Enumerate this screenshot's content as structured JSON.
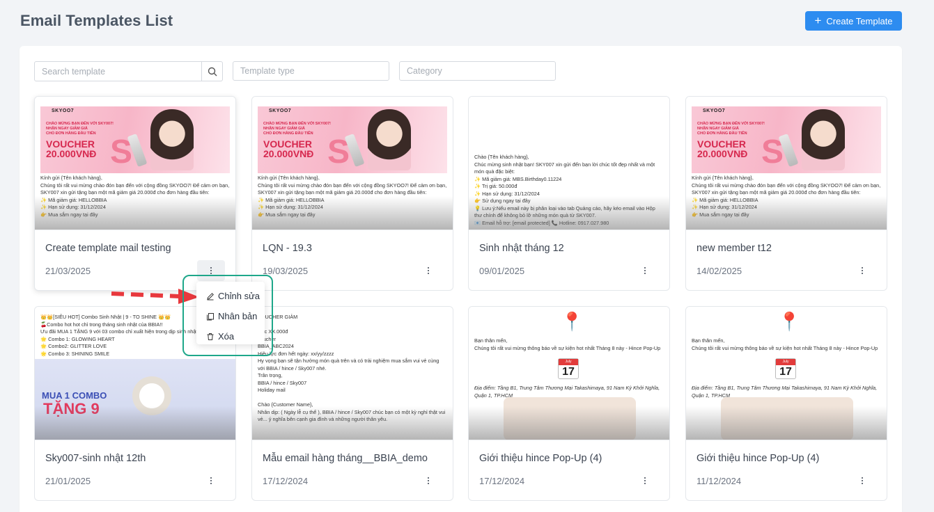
{
  "header": {
    "title": "Email Templates List",
    "create_label": "Create Template"
  },
  "filters": {
    "search_placeholder": "Search template",
    "type_placeholder": "Template type",
    "category_placeholder": "Category"
  },
  "cards": [
    {
      "name": "Create template mail testing",
      "date": "21/03/2025",
      "thumb": "voucher"
    },
    {
      "name": "LQN - 19.3",
      "date": "19/03/2025",
      "thumb": "voucher"
    },
    {
      "name": "Sinh nhật tháng 12",
      "date": "09/01/2025",
      "thumb": "birthday"
    },
    {
      "name": "new member t12",
      "date": "14/02/2025",
      "thumb": "voucher"
    },
    {
      "name": "Sky007-sinh nhật 12th",
      "date": "21/01/2025",
      "thumb": "bbia"
    },
    {
      "name": "Mẫu email hàng tháng__BBIA_demo",
      "date": "17/12/2024",
      "thumb": "monthly"
    },
    {
      "name": "Giới thiệu hince Pop-Up (4)",
      "date": "17/12/2024",
      "thumb": "popup"
    },
    {
      "name": "Giới thiệu hince Pop-Up (4)",
      "date": "11/12/2024",
      "thumb": "popup"
    }
  ],
  "menu": {
    "edit": "Chỉnh sửa",
    "duplicate": "Nhân bản",
    "delete": "Xóa"
  },
  "thumbs": {
    "voucher": {
      "brand": "SKYOO7",
      "small": "CHÀO MỪNG BẠN ĐẾN VỚI SKY007!\nNHẬN NGAY GIẢM GIÁ\nCHO ĐƠN HÀNG ĐẦU TIÊN",
      "voucher": "VOUCHER\n20.000VNĐ",
      "body": "Kính gửi {Tên khách hàng},\nChúng tôi rất vui mừng chào đón bạn đến với cộng đồng SKYOO7! Để cảm ơn bạn, SKY007 xin gửi tặng bạn một mã giảm giá 20.000đ cho đơn hàng đầu tiên:\n✨ Mã giảm giá: HELLOBBIA\n✨ Hạn sử dụng: 31/12/2024\n👉 Mua sắm ngay tại đây"
    },
    "birthday": {
      "body": "Chào {Tên khách hàng},\nChúc mừng sinh nhật bạn! SKY007 xin gửi đến bạn lời chúc tốt đẹp nhất và một món quà đặc biệt:\n✨ Mã giảm giá: MBS.Birthday0.11224\n✨ Trị giá: 50.000đ\n✨ Hạn sử dụng: 31/12/2024\n👉 Sử dụng ngay tại đây\n💡 Lưu ý:Nếu email này bị phân loại vào tab Quảng cáo, hãy kéo email vào Hộp thư chính để không bỏ lỡ những món quà từ SKY007.\n📧 Email hỗ trợ: [email protected] 📞 Hotline: 0917.027.980"
    },
    "bbia": {
      "body": "👑👑[SIÊU HOT] Combo Sinh Nhật | 9 - TO SHINE 👑👑\n🍒Combo hot hot chỉ trong tháng sinh nhật của BBIA!!\nƯu đãi MUA 1 TẶNG 9 với 03 combo chỉ xuất hiện trong dịp sinh nhật:\n🌟 Combo 1: GLOWING HEART\n🌟 Combo2: GLITTER LOVE\n🌟 Combo 3: SHINING SMILE",
      "combo": "MUA 1 COMBO",
      "tang": "TẶNG 9"
    },
    "monthly": {
      "body": "VOUCHER GIẢM\n\nước XX.000đ\nvoucher\nBBIA_ABC2024\nHiệu lực đơn hết ngày: xx/yy/zzzz\nHy vọng bạn sẽ tận hưởng món quà trên và có trải nghiệm mua sắm vui vẻ cùng với BBIA / hince / Sky007 nhé.\nTrân trọng,\nBBIA / hince / Sky007\nHoliday mail\n\nChào {Customer Name},\nNhân dịp: ( Ngày lễ cụ thể ), BBIA / hince / Sky007 chúc bạn có một kỳ nghỉ thật vui vẻ... ý nghĩa bên cạnh gia đình và những người thân yêu."
    },
    "popup": {
      "body": "Bạn thân mến,\nChúng tôi rất vui mừng thông báo về sự kiện hot nhất Tháng 8 này - Hince Pop-Up",
      "place": "Địa điểm: Tầng B1, Trung Tâm Thương Mại Takashimaya, 91 Nam Kỳ Khởi Nghĩa, Quận 1, TP.HCM",
      "cal_month": "July",
      "cal_day": "17"
    }
  }
}
